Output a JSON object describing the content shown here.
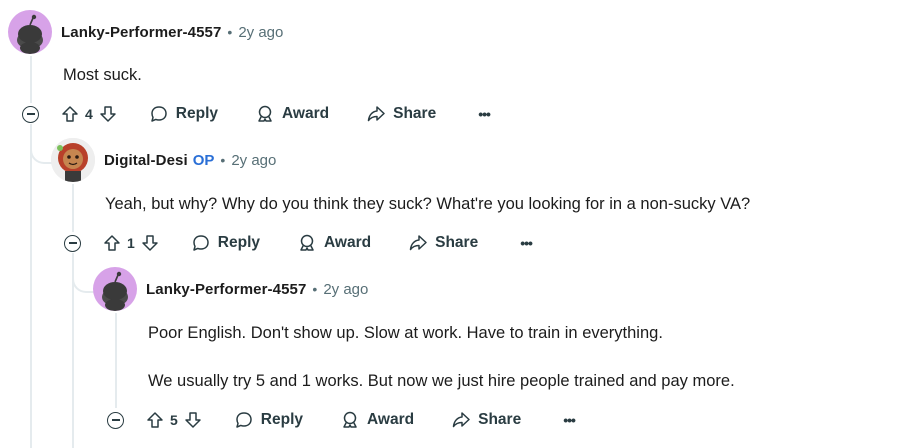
{
  "comments": [
    {
      "username": "Lanky-Performer-4557",
      "op_badge": "",
      "separator": "•",
      "timestamp": "2y ago",
      "body": [
        "Most suck."
      ],
      "votes": "4",
      "reply_label": "Reply",
      "award_label": "Award",
      "share_label": "Share",
      "more_label": "•••",
      "avatar_icon": "snoo-avatar-icon"
    },
    {
      "username": "Digital-Desi",
      "op_badge": "OP",
      "separator": "•",
      "timestamp": "2y ago",
      "body": [
        "Yeah, but why? Why do you think they suck? What're you looking for in a non-sucky VA?"
      ],
      "votes": "1",
      "reply_label": "Reply",
      "award_label": "Award",
      "share_label": "Share",
      "more_label": "•••",
      "avatar_icon": "user-avatar-icon"
    },
    {
      "username": "Lanky-Performer-4557",
      "op_badge": "",
      "separator": "•",
      "timestamp": "2y ago",
      "body": [
        "Poor English. Don't show up. Slow at work. Have to train in everything.",
        "We usually try 5 and 1 works. But now we just hire people trained and pay more."
      ],
      "votes": "5",
      "reply_label": "Reply",
      "award_label": "Award",
      "share_label": "Share",
      "more_label": "•••",
      "avatar_icon": "snoo-avatar-icon"
    }
  ],
  "colors": {
    "text": "#1c1c1c",
    "meta": "#576f76",
    "icon": "#2a3c42",
    "op": "#2a6fd6",
    "snoo_bg": "#d7a2e8",
    "thread_line": "#e5ebee"
  }
}
